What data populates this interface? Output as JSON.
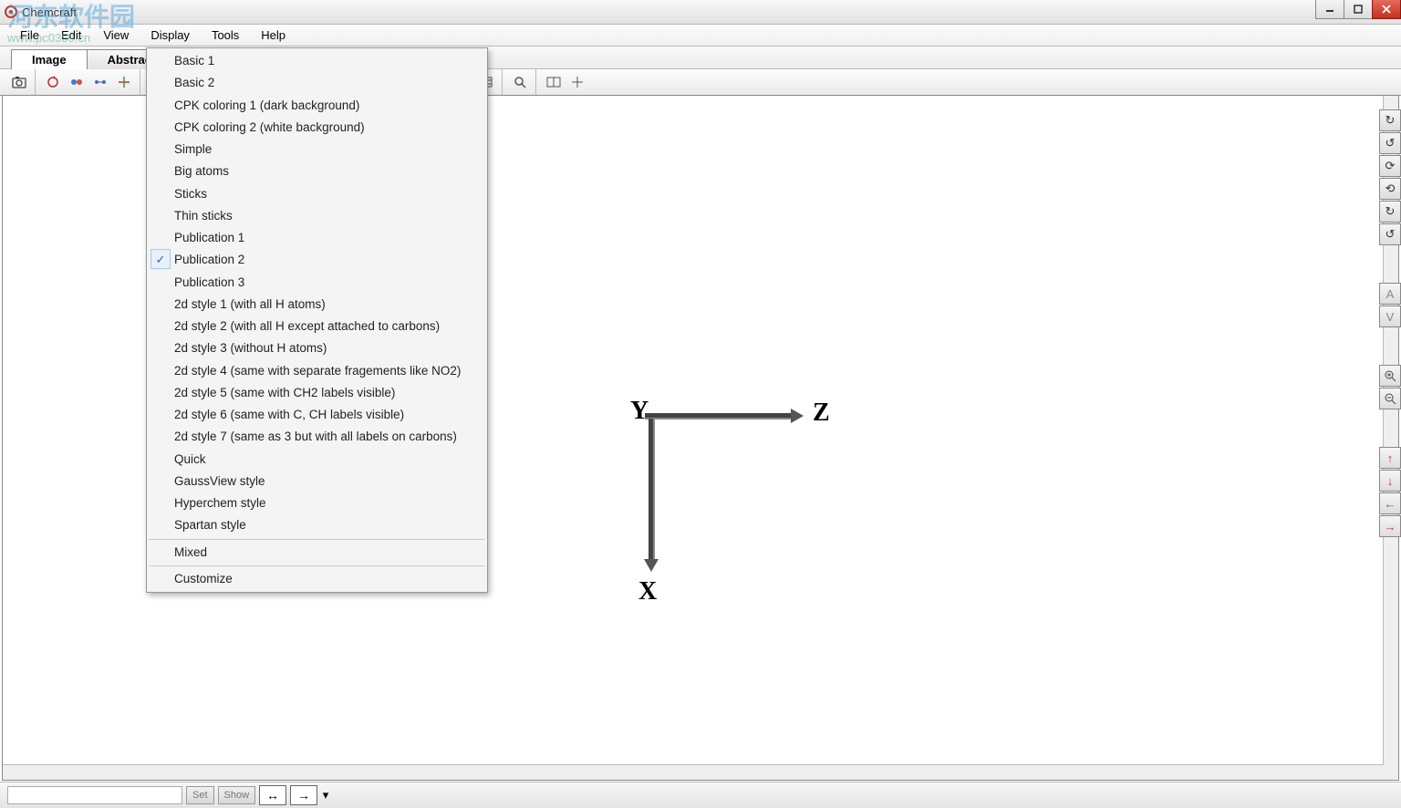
{
  "window": {
    "title": "Chemcraft"
  },
  "menu": {
    "file": "File",
    "edit": "Edit",
    "view": "View",
    "display": "Display",
    "tools": "Tools",
    "help": "Help"
  },
  "tabs": {
    "image": "Image",
    "abstract": "Abstract"
  },
  "dropdown": {
    "items": [
      "Basic 1",
      "Basic 2",
      "CPK coloring 1 (dark background)",
      "CPK coloring 2 (white background)",
      "Simple",
      "Big atoms",
      "Sticks",
      "Thin sticks",
      "Publication 1",
      "Publication 2",
      "Publication 3",
      "2d style 1 (with all H atoms)",
      "2d style 2 (with all H except attached to carbons)",
      "2d style 3 (without H atoms)",
      "2d style 4 (same with separate fragements like NO2)",
      "2d style 5 (same with CH2 labels visible)",
      "2d style 6 (same with C, CH labels visible)",
      "2d style 7 (same as 3 but with all labels on carbons)",
      "Quick",
      "GaussView style",
      "Hyperchem style",
      "Spartan style"
    ],
    "mixed": "Mixed",
    "customize": "Customize",
    "checked_index": 9
  },
  "axes": {
    "x": "X",
    "y": "Y",
    "z": "Z"
  },
  "statusbar": {
    "set": "Set",
    "show": "Show"
  },
  "watermark": {
    "main": "河东软件园",
    "sub": "www.pc0359.cn"
  }
}
